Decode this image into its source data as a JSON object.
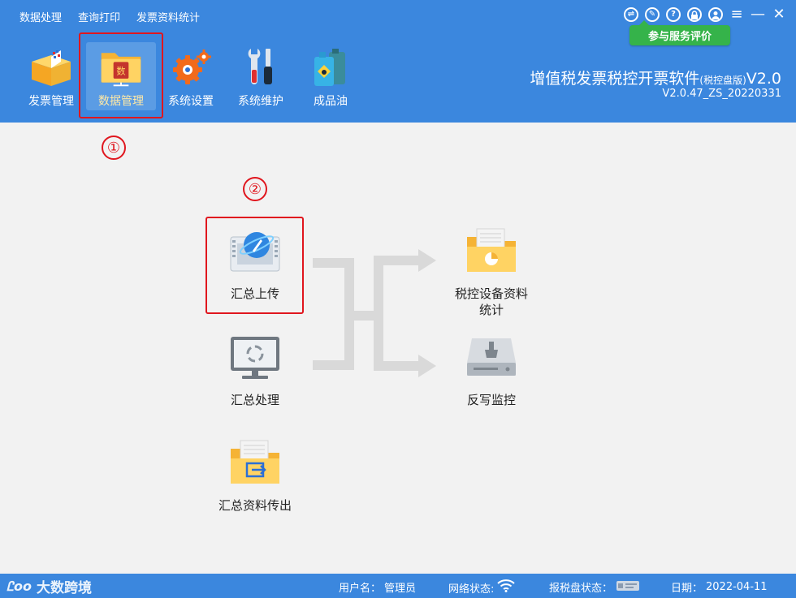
{
  "menu": [
    "数据处理",
    "查询打印",
    "发票资料统计"
  ],
  "window_controls": [
    {
      "name": "swap-icon",
      "glyph": "⇌"
    },
    {
      "name": "feedback-icon",
      "glyph": "✎"
    },
    {
      "name": "help-icon",
      "glyph": "?"
    },
    {
      "name": "lock-icon",
      "glyph": "🔒"
    },
    {
      "name": "user-icon",
      "glyph": "👤"
    },
    {
      "name": "menu-icon",
      "glyph": "≡"
    },
    {
      "name": "minimize-icon",
      "glyph": "—"
    },
    {
      "name": "close-icon",
      "glyph": "✕"
    }
  ],
  "eval_button": "参与服务评价",
  "toolbar": [
    {
      "label": "发票管理",
      "icon": "invoice-box-icon"
    },
    {
      "label": "数据管理",
      "icon": "data-folder-icon",
      "active": true
    },
    {
      "label": "系统设置",
      "icon": "gears-icon"
    },
    {
      "label": "系统维护",
      "icon": "tools-icon"
    },
    {
      "label": "成品油",
      "icon": "oil-can-icon"
    }
  ],
  "app": {
    "title": "增值税发票税控开票软件",
    "title_suffix": "(税控盘版)",
    "title_version": "V2.0",
    "version": "V2.0.47_ZS_20220331"
  },
  "annotations": {
    "step1": "①",
    "step2": "②"
  },
  "functions": {
    "summary_upload": "汇总上传",
    "summary_process": "汇总处理",
    "summary_export": "汇总资料传出",
    "device_stats_line1": "税控设备资料",
    "device_stats_line2": "统计",
    "writeback_monitor": "反写监控"
  },
  "status": {
    "logo_text": "大数跨境",
    "user_label": "用户名：",
    "user_value": "管理员",
    "network_label": "网络状态:",
    "disk_label": "报税盘状态：",
    "date_label": "日期：",
    "date_value": "2022-04-11"
  },
  "colors": {
    "primary": "#3b87de",
    "accent_green": "#35b34a",
    "highlight_red": "#e0161e"
  }
}
